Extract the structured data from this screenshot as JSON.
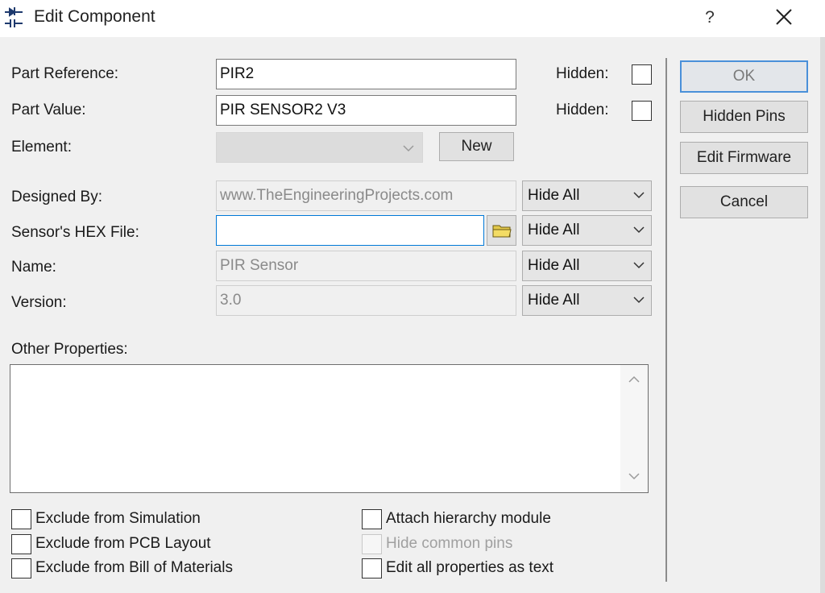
{
  "window": {
    "title": "Edit Component",
    "help_label": "?",
    "close_icon": "close-icon",
    "app_icon": "component-icon"
  },
  "form": {
    "part_reference": {
      "label": "Part Reference:",
      "value": "PIR2",
      "hidden_label": "Hidden:",
      "hidden": false
    },
    "part_value": {
      "label": "Part Value:",
      "value": "PIR SENSOR2 V3",
      "hidden_label": "Hidden:",
      "hidden": false
    },
    "element": {
      "label": "Element:",
      "value": "",
      "new_button": "New"
    },
    "properties": [
      {
        "label": "Designed By:",
        "value": "www.TheEngineeringProjects.com",
        "visibility": "Hide All"
      },
      {
        "label": "Sensor's HEX File:",
        "value": "",
        "visibility": "Hide All"
      },
      {
        "label": "Name:",
        "value": "PIR Sensor",
        "visibility": "Hide All"
      },
      {
        "label": "Version:",
        "value": "3.0",
        "visibility": "Hide All"
      }
    ],
    "other_properties": {
      "label": "Other Properties:",
      "value": ""
    }
  },
  "buttons": {
    "ok": "OK",
    "hidden_pins": "Hidden Pins",
    "edit_firmware": "Edit Firmware",
    "cancel": "Cancel"
  },
  "options": {
    "left": [
      {
        "label": "Exclude from Simulation",
        "checked": false
      },
      {
        "label": "Exclude from PCB Layout",
        "checked": false
      },
      {
        "label": "Exclude from Bill of Materials",
        "checked": false
      }
    ],
    "right": [
      {
        "label": "Attach hierarchy module",
        "checked": false,
        "enabled": true
      },
      {
        "label": "Hide common pins",
        "checked": false,
        "enabled": false
      },
      {
        "label": "Edit all properties as text",
        "checked": false,
        "enabled": true
      }
    ]
  },
  "colors": {
    "accent": "#0078d7",
    "default_button_border": "#4a90d9",
    "folder_icon": "#d9c13a"
  }
}
